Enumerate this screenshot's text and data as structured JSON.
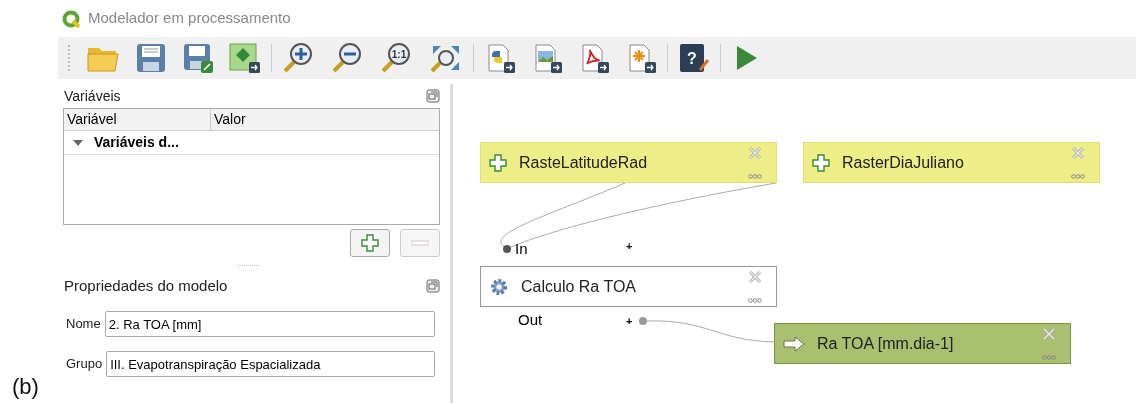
{
  "window": {
    "title": "Modelador em processamento"
  },
  "toolbar": [
    [
      {
        "kind": "open"
      },
      {
        "kind": "save"
      },
      {
        "kind": "save_as"
      },
      {
        "kind": "export_layer"
      }
    ],
    [
      {
        "kind": "zoom_in"
      },
      {
        "kind": "zoom_out"
      },
      {
        "kind": "zoom_actual",
        "label": "1:1"
      },
      {
        "kind": "zoom_full"
      }
    ],
    [
      {
        "kind": "export_python"
      },
      {
        "kind": "export_image"
      },
      {
        "kind": "export_pdf"
      },
      {
        "kind": "export_svg"
      }
    ],
    [
      {
        "kind": "help",
        "label": "?"
      }
    ],
    [
      {
        "kind": "run"
      }
    ]
  ],
  "variables_panel": {
    "title": "Variáveis",
    "columns": [
      "Variável",
      "Valor"
    ],
    "rows": [
      {
        "label": "Variáveis d...",
        "expanded": true
      }
    ]
  },
  "properties_panel": {
    "title": "Propriedades do modelo",
    "fields": [
      {
        "label": "Nome",
        "value": "2. Ra TOA [mm]"
      },
      {
        "label": "Grupo",
        "value": "III. Evapotranspiração Espacializada"
      }
    ]
  },
  "canvas": {
    "inputs": [
      {
        "label": "RasteLatitudeRad"
      },
      {
        "label": "RasterDiaJuliano"
      }
    ],
    "algorithm": {
      "label": "Calculo Ra TOA",
      "in_label": "In",
      "out_label": "Out",
      "port_toggle": "+"
    },
    "outputs": [
      {
        "label": "Ra TOA [mm.dia-1]"
      }
    ]
  },
  "figure_label": "(b)"
}
